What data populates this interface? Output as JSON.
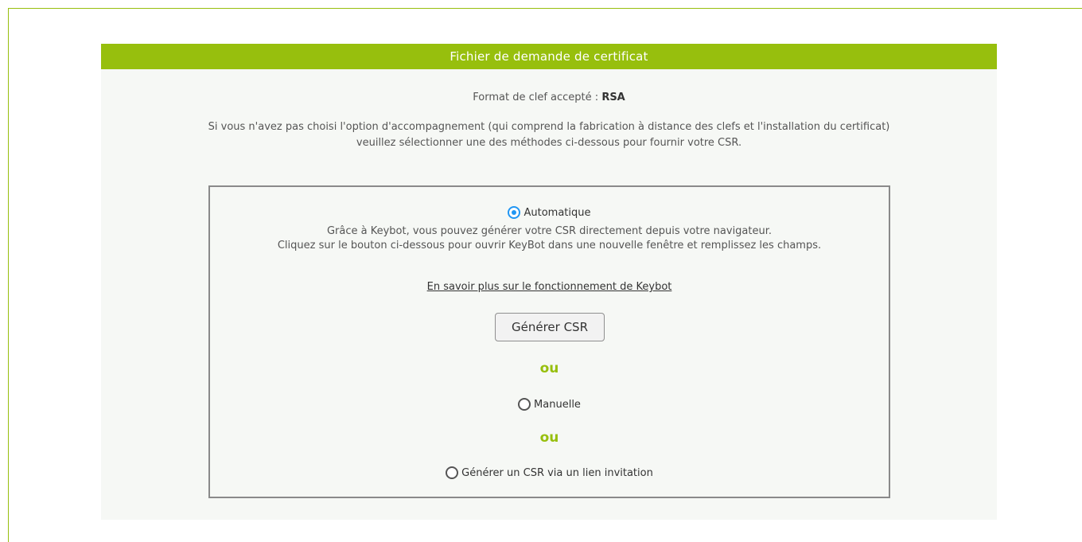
{
  "panel": {
    "header": "Fichier de demande de certificat",
    "key_format_label": "Format de clef accepté :",
    "key_format_value": "RSA",
    "intro_line1": "Si vous n'avez pas choisi l'option d'accompagnement (qui comprend la fabrication à distance des clefs et l'installation du certificat)",
    "intro_line2": "veuillez sélectionner une des méthodes ci-dessous pour fournir votre CSR."
  },
  "methods": {
    "automatic": {
      "label": "Automatique",
      "selected": true,
      "desc_line1": "Grâce à Keybot, vous pouvez générer votre CSR directement depuis votre navigateur.",
      "desc_line2": "Cliquez sur le bouton ci-dessous pour ouvrir KeyBot dans une nouvelle fenêtre et remplissez les champs.",
      "learn_more": "En savoir plus sur le fonctionnement de Keybot",
      "button": "Générer CSR"
    },
    "separator": "ou",
    "manual": {
      "label": "Manuelle",
      "selected": false
    },
    "invite": {
      "label": "Générer un CSR via un lien invitation",
      "selected": false
    }
  },
  "colors": {
    "accent": "#97bf0d",
    "radio_selected": "#2196f3",
    "panel_bg": "#f6f8f5"
  }
}
